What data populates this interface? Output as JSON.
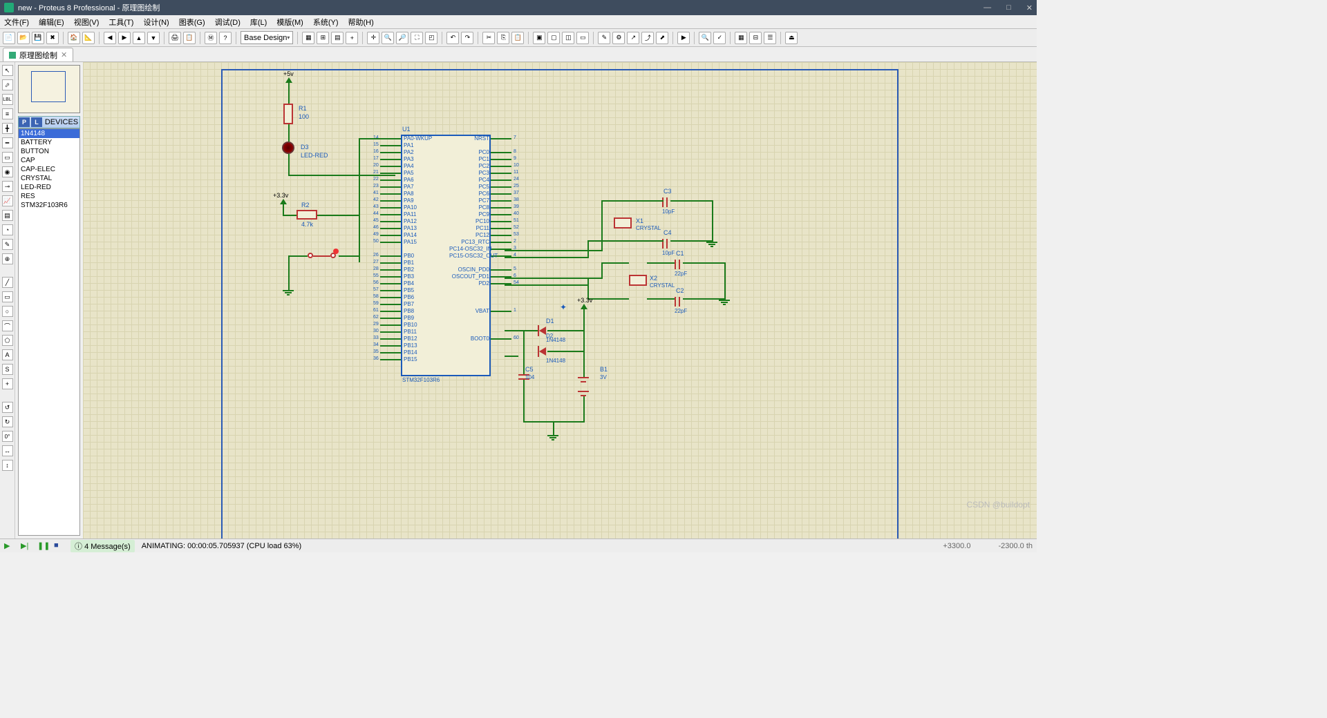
{
  "title": "new - Proteus 8 Professional - 原理图绘制",
  "menu": [
    "文件(F)",
    "编辑(E)",
    "视图(V)",
    "工具(T)",
    "设计(N)",
    "图表(G)",
    "调试(D)",
    "库(L)",
    "模版(M)",
    "系统(Y)",
    "帮助(H)"
  ],
  "combo": "Base Design",
  "tab": {
    "label": "原理图绘制"
  },
  "devhdr": {
    "p": "P",
    "l": "L",
    "title": "DEVICES"
  },
  "devices": [
    "1N4148",
    "BATTERY",
    "BUTTON",
    "CAP",
    "CAP-ELEC",
    "CRYSTAL",
    "LED-RED",
    "RES",
    "STM32F103R6"
  ],
  "schem": {
    "pwr5v": "+5v",
    "pwr33": "+3.3v",
    "R1": {
      "ref": "R1",
      "val": "100"
    },
    "R2": {
      "ref": "R2",
      "val": "4.7k"
    },
    "D3": {
      "ref": "D3",
      "val": "LED-RED"
    },
    "U1": {
      "ref": "U1",
      "val": "STM32F103R6",
      "left": [
        {
          "n": "14",
          "t": "PA0-WKUP"
        },
        {
          "n": "15",
          "t": "PA1"
        },
        {
          "n": "16",
          "t": "PA2"
        },
        {
          "n": "17",
          "t": "PA3"
        },
        {
          "n": "20",
          "t": "PA4"
        },
        {
          "n": "21",
          "t": "PA5"
        },
        {
          "n": "22",
          "t": "PA6"
        },
        {
          "n": "23",
          "t": "PA7"
        },
        {
          "n": "41",
          "t": "PA8"
        },
        {
          "n": "42",
          "t": "PA9"
        },
        {
          "n": "43",
          "t": "PA10"
        },
        {
          "n": "44",
          "t": "PA11"
        },
        {
          "n": "45",
          "t": "PA12"
        },
        {
          "n": "46",
          "t": "PA13"
        },
        {
          "n": "49",
          "t": "PA14"
        },
        {
          "n": "50",
          "t": "PA15"
        },
        {
          "n": "",
          "t": ""
        },
        {
          "n": "26",
          "t": "PB0"
        },
        {
          "n": "27",
          "t": "PB1"
        },
        {
          "n": "28",
          "t": "PB2"
        },
        {
          "n": "55",
          "t": "PB3"
        },
        {
          "n": "56",
          "t": "PB4"
        },
        {
          "n": "57",
          "t": "PB5"
        },
        {
          "n": "58",
          "t": "PB6"
        },
        {
          "n": "59",
          "t": "PB7"
        },
        {
          "n": "61",
          "t": "PB8"
        },
        {
          "n": "62",
          "t": "PB9"
        },
        {
          "n": "29",
          "t": "PB10"
        },
        {
          "n": "30",
          "t": "PB11"
        },
        {
          "n": "33",
          "t": "PB12"
        },
        {
          "n": "34",
          "t": "PB13"
        },
        {
          "n": "35",
          "t": "PB14"
        },
        {
          "n": "36",
          "t": "PB15"
        }
      ],
      "right": [
        {
          "n": "7",
          "t": "NRST"
        },
        {
          "n": "",
          "t": ""
        },
        {
          "n": "8",
          "t": "PC0"
        },
        {
          "n": "9",
          "t": "PC1"
        },
        {
          "n": "10",
          "t": "PC2"
        },
        {
          "n": "11",
          "t": "PC3"
        },
        {
          "n": "24",
          "t": "PC4"
        },
        {
          "n": "25",
          "t": "PC5"
        },
        {
          "n": "37",
          "t": "PC6"
        },
        {
          "n": "38",
          "t": "PC7"
        },
        {
          "n": "39",
          "t": "PC8"
        },
        {
          "n": "40",
          "t": "PC9"
        },
        {
          "n": "51",
          "t": "PC10"
        },
        {
          "n": "52",
          "t": "PC11"
        },
        {
          "n": "53",
          "t": "PC12"
        },
        {
          "n": "2",
          "t": "PC13_RTC"
        },
        {
          "n": "3",
          "t": "PC14-OSC32_IN"
        },
        {
          "n": "4",
          "t": "PC15-OSC32_OUT"
        },
        {
          "n": "",
          "t": ""
        },
        {
          "n": "5",
          "t": "OSCIN_PD0"
        },
        {
          "n": "6",
          "t": "OSCOUT_PD1"
        },
        {
          "n": "54",
          "t": "PD2"
        },
        {
          "n": "",
          "t": ""
        },
        {
          "n": "",
          "t": ""
        },
        {
          "n": "",
          "t": ""
        },
        {
          "n": "1",
          "t": "VBAT"
        },
        {
          "n": "",
          "t": ""
        },
        {
          "n": "",
          "t": ""
        },
        {
          "n": "",
          "t": ""
        },
        {
          "n": "60",
          "t": "BOOT0"
        }
      ]
    },
    "D1": {
      "ref": "D1",
      "val": "1N4148"
    },
    "D2": {
      "ref": "D2",
      "val": "1N4148"
    },
    "C1": {
      "ref": "C1",
      "val": "22pF"
    },
    "C2": {
      "ref": "C2",
      "val": "22pF"
    },
    "C3": {
      "ref": "C3",
      "val": "10pF"
    },
    "C4": {
      "ref": "C4",
      "val": "10pF"
    },
    "C5": {
      "ref": "C5",
      "val": "104"
    },
    "X1": {
      "ref": "X1",
      "val": "CRYSTAL"
    },
    "X2": {
      "ref": "X2",
      "val": "CRYSTAL"
    },
    "B1": {
      "ref": "B1",
      "val": "3V"
    }
  },
  "status": {
    "msgs": "4 Message(s)",
    "anim": "ANIMATING: 00:00:05.705937 (CPU load 63%)",
    "coord1": "+3300.0",
    "coord2": "-2300.0 th"
  },
  "watermark": "CSDN @buildopt"
}
